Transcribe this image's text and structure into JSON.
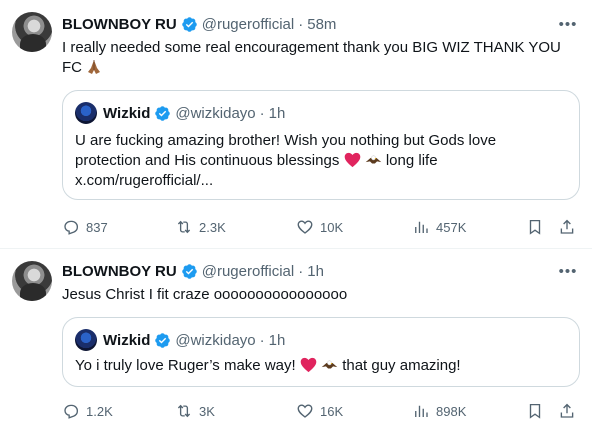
{
  "tweets": [
    {
      "name": "BLOWNBOY RU",
      "handle": "@rugerofficial",
      "dot": "·",
      "time": "58m",
      "text": "I really needed some real encouragement thank you BIG WIZ THANK YOU FC",
      "quote": {
        "name": "Wizkid",
        "handle": "@wizkidayo",
        "dot": "·",
        "time": "1h",
        "line1": "U are fucking amazing brother! Wish you nothing but Gods love",
        "line2a": "protection and His continuous blessings",
        "line2b": "long life",
        "line3": "x.com/rugerofficial/..."
      },
      "stats": {
        "replies": "837",
        "reposts": "2.3K",
        "likes": "10K",
        "views": "457K"
      }
    },
    {
      "name": "BLOWNBOY RU",
      "handle": "@rugerofficial",
      "dot": "·",
      "time": "1h",
      "text": "Jesus Christ I fit craze oooooooooooooooo",
      "quote": {
        "name": "Wizkid",
        "handle": "@wizkidayo",
        "dot": "·",
        "time": "1h",
        "line1a": "Yo i truly love Ruger’s make way!",
        "line1b": "that guy amazing!"
      },
      "stats": {
        "replies": "1.2K",
        "reposts": "3K",
        "likes": "16K",
        "views": "898K"
      }
    }
  ],
  "colors": {
    "verified": "#1d9bf0",
    "heart": "#e0245e",
    "muted": "#536471",
    "border": "#cfd9de"
  }
}
